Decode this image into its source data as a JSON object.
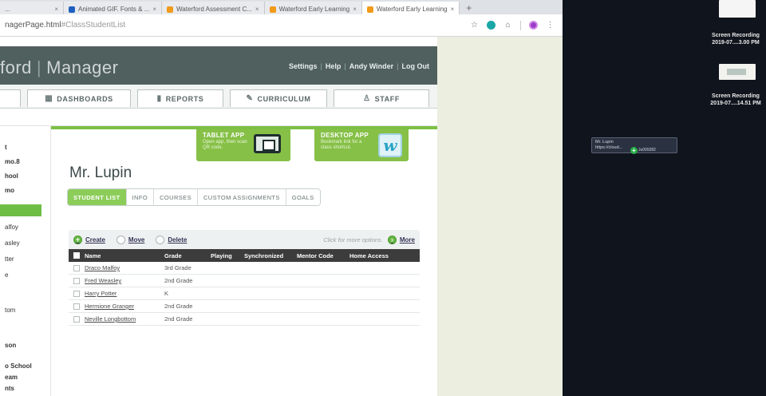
{
  "browser": {
    "tabs": [
      {
        "label": "..."
      },
      {
        "label": "Animated GIF. Fonts & ..."
      },
      {
        "label": "Waterford Assessment C..."
      },
      {
        "label": "Waterford Early Learning"
      },
      {
        "label": "Waterford Early Learning",
        "active": true
      }
    ],
    "new_tab": "+",
    "url_prefix": "nagerPage.html",
    "url_hash": "#ClassStudentList"
  },
  "app": {
    "brand_left": "ford",
    "brand_right": "Manager",
    "header_links": [
      "Settings",
      "Help",
      "Andy Winder",
      "Log Out"
    ],
    "nav_tabs": [
      {
        "label": "DASHBOARDS",
        "icon": "dashboard-icon"
      },
      {
        "label": "REPORTS",
        "icon": "bar-chart-icon"
      },
      {
        "label": "CURRICULUM",
        "icon": "curriculum-icon"
      },
      {
        "label": "STAFF",
        "icon": "staff-icon"
      }
    ],
    "sidebar": [
      {
        "label": "t"
      },
      {
        "label": "mo.8"
      },
      {
        "label": "hool"
      },
      {
        "label": "mo"
      },
      {
        "label": "alfoy"
      },
      {
        "label": "asley"
      },
      {
        "label": "tter"
      },
      {
        "label": "e"
      },
      {
        "label": "tom"
      },
      {
        "label": "son"
      },
      {
        "label": "o School"
      },
      {
        "label": "eam"
      },
      {
        "label": "nts"
      }
    ],
    "promos": [
      {
        "title": "TABLET APP",
        "sub": "Open app, then scan QR code.",
        "graphic": "tablet-icon"
      },
      {
        "title": "DESKTOP APP",
        "sub": "Bookmark link for a class shortcut.",
        "graphic": "waterford-w-logo"
      }
    ],
    "teacher_name": "Mr. Lupin",
    "sub_tabs": [
      {
        "label": "STUDENT LIST",
        "active": true
      },
      {
        "label": "INFO"
      },
      {
        "label": "COURSES"
      },
      {
        "label": "CUSTOM ASSIGNMENTS"
      },
      {
        "label": "GOALS"
      }
    ],
    "toolbar": {
      "create": "Create",
      "move": "Move",
      "delete": "Delete",
      "hint": "Click for more options.",
      "more": "More"
    },
    "table": {
      "headers": [
        "Name",
        "Grade",
        "Playing",
        "Synchronized",
        "Mentor Code",
        "Home Access"
      ],
      "rows": [
        {
          "name": "Draco Malfoy",
          "grade": "3rd Grade"
        },
        {
          "name": "Fred Weasley",
          "grade": "2nd Grade"
        },
        {
          "name": "Harry Potter",
          "grade": "K"
        },
        {
          "name": "Hermione Granger",
          "grade": "2nd Grade"
        },
        {
          "name": "Neville Longbottom",
          "grade": "2nd Grade"
        }
      ]
    }
  },
  "desktop": {
    "files": [
      {
        "line1": "Screen Recording",
        "line2": "2019-07....3.00 PM"
      },
      {
        "line1": "Screen Recording",
        "line2": "2019-07....14.51 PM"
      }
    ],
    "drag_tip": {
      "title": "Mr. Lupin",
      "url": "https://cloud...",
      "badge": "+",
      "chip": "Ju099282"
    }
  }
}
